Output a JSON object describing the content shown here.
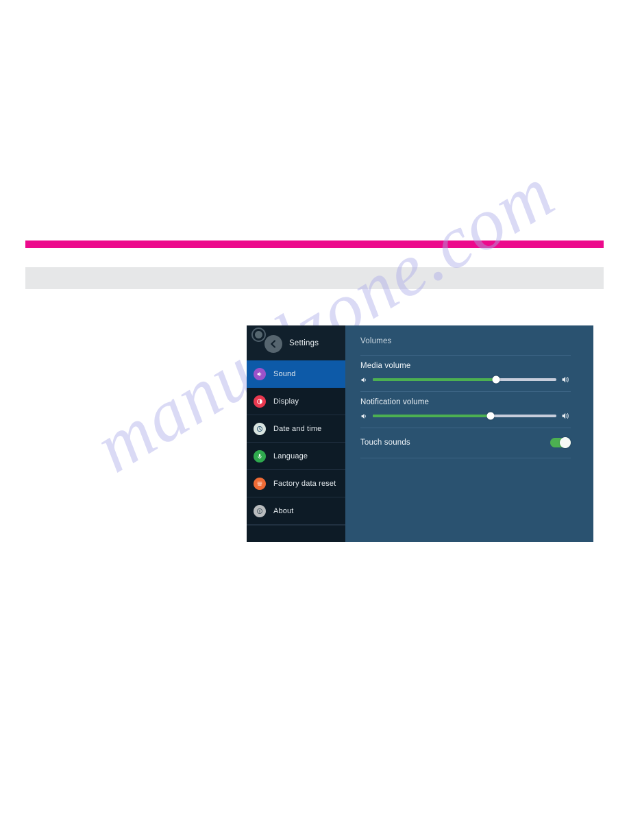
{
  "page": {
    "background_color": "#ffffff",
    "accent_bar_color": "#ec0a8c",
    "gray_bar_color": "#e6e7e8",
    "watermark_text": "manualzone.com"
  },
  "device": {
    "screen_background": "#2a5270",
    "sidebar_background": "#0d1b26",
    "selected_color": "#0d5aa8",
    "header": {
      "title": "Settings",
      "logo_icon": "concentric-circle-logo",
      "back_icon": "chevron-left-icon"
    },
    "sidebar": {
      "items": [
        {
          "label": "Sound",
          "icon": "speaker-icon",
          "icon_color": "#9b52c9",
          "selected": true
        },
        {
          "label": "Display",
          "icon": "brightness-icon",
          "icon_color": "#e8384f",
          "selected": false
        },
        {
          "label": "Date and time",
          "icon": "clock-icon",
          "icon_color": "#d8e4e0",
          "selected": false
        },
        {
          "label": "Language",
          "icon": "microphone-icon",
          "icon_color": "#2faa4e",
          "selected": false
        },
        {
          "label": "Factory data reset",
          "icon": "reset-icon",
          "icon_color": "#ef6b35",
          "selected": false
        },
        {
          "label": "About",
          "icon": "info-icon",
          "icon_color": "#b9bcbe",
          "selected": false
        }
      ]
    },
    "content": {
      "section_title": "Volumes",
      "media_volume": {
        "label": "Media volume",
        "value_percent": 67,
        "left_icon": "volume-low-icon",
        "right_icon": "volume-high-icon",
        "fill_color": "#4cb051",
        "track_color": "#c7cddb"
      },
      "notification_volume": {
        "label": "Notification volume",
        "value_percent": 64,
        "left_icon": "volume-low-icon",
        "right_icon": "volume-high-icon",
        "fill_color": "#4cb051",
        "track_color": "#c7cddb"
      },
      "touch_sounds": {
        "label": "Touch sounds",
        "enabled": true,
        "on_color": "#4cb051"
      }
    }
  }
}
